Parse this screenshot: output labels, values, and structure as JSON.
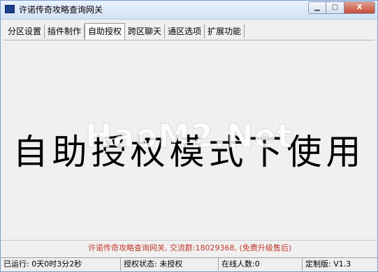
{
  "window": {
    "title": "许诺传奇攻略查询网关",
    "buttons": {
      "minimize": "▁",
      "maximize": "▢",
      "close": "X"
    }
  },
  "tabs": [
    {
      "label": "分区设置"
    },
    {
      "label": "插件制作"
    },
    {
      "label": "自助授权"
    },
    {
      "label": "跨区聊天"
    },
    {
      "label": "通区选项"
    },
    {
      "label": "扩展功能"
    }
  ],
  "active_tab_index": 2,
  "main": {
    "big_text": "自助授权模式下使用",
    "overlay_text": "HaoM2.Net"
  },
  "footer_note": "许诺传奇攻略查询网关, 交流群:18029368, (免费升级售后)",
  "statusbar": {
    "runtime": "已运行: 0天0时3分2秒",
    "auth_status": "授权状态: 未授权",
    "online": "在线人数:0",
    "version": "定制版: V1.3"
  },
  "colors": {
    "footer_note": "#c0392b",
    "titlebar_accent": "#1b3f8f"
  }
}
